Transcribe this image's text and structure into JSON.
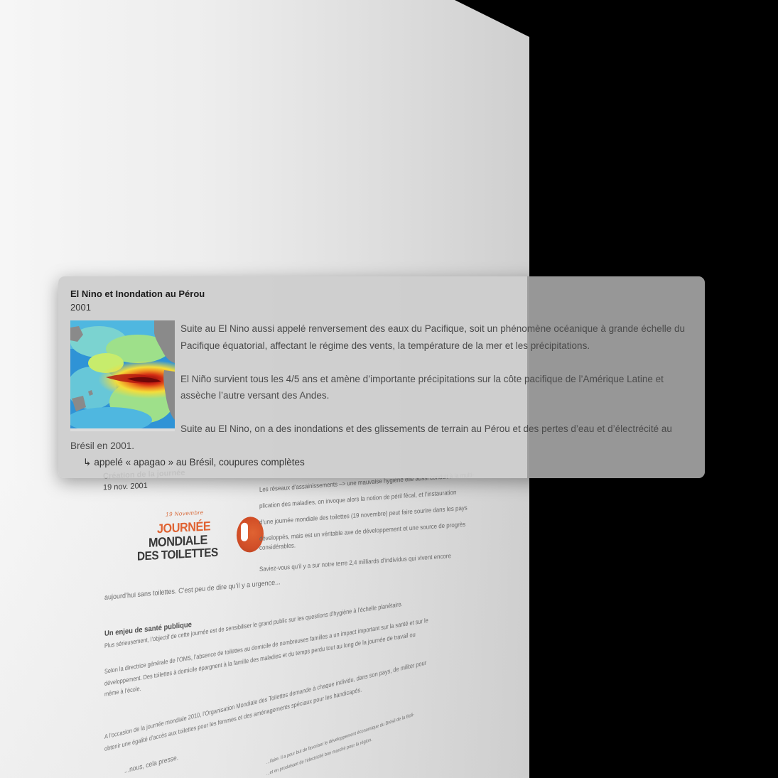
{
  "card": {
    "title": "El Nino et Inondation au Pérou",
    "year": "2001",
    "image_icon": "el-nino-sea-temperature-map",
    "paragraphs": [
      "Suite au El Nino aussi appelé renversement des eaux du Pacifique, soit un phénomène océanique à grande échelle du Pacifique équatorial, affectant le régime des vents, la température de la mer et les précipitations.",
      "El Niño survient tous les 4/5 ans et amène d’importante précipitations sur la côte pacifique de l’Amérique Latine et assèche l’autre versant des Andes.",
      "Suite au El Nino, on a des inondations et des glissements de terrain au Pérou et des pertes d’eau et d’électrécité au Brésil en 2001."
    ],
    "sub_arrow": "↳",
    "sub_item": "appelé « apagao » au Brésil, coupures complètes"
  },
  "doc": {
    "meta_title": "Création de la journée",
    "meta_date": "19 nov. 2001",
    "logo": {
      "small": "19 Novembre",
      "line1": "JOURNÉE",
      "line2": "MONDIALE",
      "line3": "DES TOILETTES"
    },
    "right_col": [
      "Les réseaux d’assainissements –> une mauvaise hygiène elle aussi conduit à la multi-",
      "plication des maladies, on invoque alors la notion de péril fécal, et l’instauration",
      "d’une journée mondiale des toilettes (19 novembre) peut faire sourire dans les pays",
      "développés, mais est un véritable axe de développement et une source de progrès",
      "considérables."
    ],
    "question": "Saviez-vous qu’il y a sur notre terre 2,4 milliards d’individus qui vivent encore",
    "line_today": "aujourd’hui sans toilettes. C’est peu de dire qu’il y a urgence...",
    "heading_health": "Un enjeu de santé publique",
    "line_health": "Plus sérieusement, l’objectif de cette journée est de sensibiliser le grand public sur les questions d’hygiène à l’échelle planétaire.",
    "line_oms1": "Selon la directrice générale de l’OMS, l’absence de toilettes au domicile de nombreuses familles a un impact important sur la santé et sur le",
    "line_oms2": "développement. Des toilettes à domicile épargnent à la famille des maladies et du temps perdu tout au long de la journée de travail ou",
    "line_oms3": "même à l’école.",
    "line_2010a": "A l’occasion de la journée mondiale 2010, l’Organisation Mondiale des Toilettes demande à chaque individu, dans son pays, de militer pour",
    "line_2010b": "obtenir une égalité d’accès aux toilettes pour les femmes et des aménagements spéciaux pour les handicapés.",
    "line_press": "...nous, cela presse.",
    "line_bottom1": "...ifaire. Il a pour but de favoriser le développement économique du Brésil de la Boli-",
    "line_bottom2": "...et en produisant de l’électricité bon marché pour la région."
  }
}
